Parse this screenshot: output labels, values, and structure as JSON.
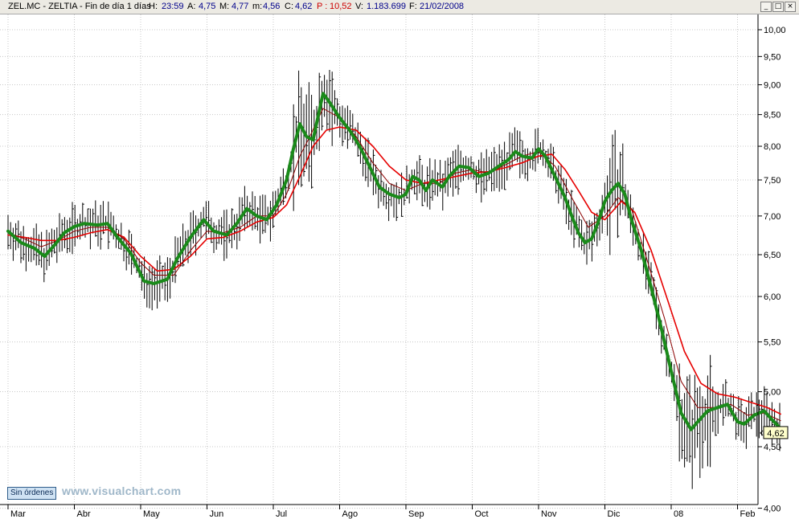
{
  "header": {
    "symbol": "ZEL.MC - ZELTIA - Fin de día 1 días",
    "h_label": "H:",
    "h_value": "23:59",
    "a_label": "A:",
    "a_value": "4,75",
    "m_label": "M:",
    "m_value": "4,77",
    "min_label": "m:",
    "min_value": "4,56",
    "c_label": "C:",
    "c_value": "4,62",
    "p_label": "P :",
    "p_value": "10,52",
    "v_label": "V:",
    "v_value": "1.183.699",
    "f_label": "F:",
    "f_value": "21/02/2008"
  },
  "window_buttons": {
    "minimize": "_",
    "maximize": "□",
    "close": "×"
  },
  "badge_label": "Sin órdenes",
  "watermark": "www.visualchart.com",
  "price_label": "4,62",
  "colors": {
    "ma_fast": "#1a8a1a",
    "ma_mid": "#8b0000",
    "ma_slow": "#e60000",
    "bars": "#000000",
    "grid": "#c8c8c8",
    "price_box": "#ffffcc"
  },
  "chart_data": {
    "type": "line",
    "y_scale": "log",
    "ylim": [
      3.87,
      10.3
    ],
    "y_ticks": [
      {
        "v": 4.0,
        "label": "4,00"
      },
      {
        "v": 4.5,
        "label": "4,50"
      },
      {
        "v": 5.0,
        "label": "5,00"
      },
      {
        "v": 5.5,
        "label": "5,50"
      },
      {
        "v": 6.0,
        "label": "6,00"
      },
      {
        "v": 6.5,
        "label": "6,50"
      },
      {
        "v": 7.0,
        "label": "7,00"
      },
      {
        "v": 7.5,
        "label": "7,50"
      },
      {
        "v": 8.0,
        "label": "8,00"
      },
      {
        "v": 8.5,
        "label": "8,50"
      },
      {
        "v": 9.0,
        "label": "9,00"
      },
      {
        "v": 9.5,
        "label": "9,50"
      },
      {
        "v": 10.0,
        "label": "10,00"
      }
    ],
    "x_ticks": [
      {
        "t": 0,
        "label": "Mar"
      },
      {
        "t": 1,
        "label": "Abr"
      },
      {
        "t": 2,
        "label": "May"
      },
      {
        "t": 3,
        "label": "Jun"
      },
      {
        "t": 4,
        "label": "Jul"
      },
      {
        "t": 5,
        "label": "Ago"
      },
      {
        "t": 6,
        "label": "Sep"
      },
      {
        "t": 7,
        "label": "Oct"
      },
      {
        "t": 8,
        "label": "Nov"
      },
      {
        "t": 9,
        "label": "Dic"
      },
      {
        "t": 10,
        "label": "08"
      },
      {
        "t": 11,
        "label": "Feb"
      }
    ],
    "t_end": 11.65,
    "last_close": 4.62,
    "grid": true,
    "series": [
      {
        "style": "bold",
        "points": [
          [
            0.0,
            6.8
          ],
          [
            0.2,
            6.65
          ],
          [
            0.4,
            6.58
          ],
          [
            0.55,
            6.48
          ],
          [
            0.7,
            6.62
          ],
          [
            0.85,
            6.78
          ],
          [
            1.0,
            6.86
          ],
          [
            1.15,
            6.9
          ],
          [
            1.35,
            6.88
          ],
          [
            1.5,
            6.9
          ],
          [
            1.65,
            6.72
          ],
          [
            1.85,
            6.52
          ],
          [
            2.05,
            6.18
          ],
          [
            2.2,
            6.15
          ],
          [
            2.4,
            6.2
          ],
          [
            2.55,
            6.45
          ],
          [
            2.75,
            6.72
          ],
          [
            2.95,
            6.95
          ],
          [
            3.1,
            6.8
          ],
          [
            3.3,
            6.75
          ],
          [
            3.45,
            6.9
          ],
          [
            3.6,
            7.1
          ],
          [
            3.75,
            7.0
          ],
          [
            3.9,
            6.95
          ],
          [
            4.05,
            7.15
          ],
          [
            4.2,
            7.5
          ],
          [
            4.3,
            7.95
          ],
          [
            4.4,
            8.35
          ],
          [
            4.5,
            8.15
          ],
          [
            4.6,
            8.1
          ],
          [
            4.7,
            8.6
          ],
          [
            4.75,
            8.85
          ],
          [
            4.85,
            8.7
          ],
          [
            5.0,
            8.45
          ],
          [
            5.15,
            8.25
          ],
          [
            5.3,
            8.0
          ],
          [
            5.45,
            7.7
          ],
          [
            5.6,
            7.4
          ],
          [
            5.75,
            7.3
          ],
          [
            5.9,
            7.25
          ],
          [
            6.0,
            7.3
          ],
          [
            6.1,
            7.55
          ],
          [
            6.2,
            7.5
          ],
          [
            6.3,
            7.35
          ],
          [
            6.4,
            7.5
          ],
          [
            6.55,
            7.4
          ],
          [
            6.65,
            7.55
          ],
          [
            6.8,
            7.7
          ],
          [
            6.95,
            7.68
          ],
          [
            7.1,
            7.55
          ],
          [
            7.25,
            7.6
          ],
          [
            7.4,
            7.7
          ],
          [
            7.55,
            7.8
          ],
          [
            7.65,
            7.92
          ],
          [
            7.75,
            7.85
          ],
          [
            7.9,
            7.82
          ],
          [
            8.0,
            7.96
          ],
          [
            8.1,
            7.85
          ],
          [
            8.25,
            7.55
          ],
          [
            8.4,
            7.25
          ],
          [
            8.5,
            7.0
          ],
          [
            8.6,
            6.78
          ],
          [
            8.7,
            6.65
          ],
          [
            8.8,
            6.7
          ],
          [
            8.9,
            6.92
          ],
          [
            9.0,
            7.2
          ],
          [
            9.1,
            7.35
          ],
          [
            9.2,
            7.45
          ],
          [
            9.3,
            7.3
          ],
          [
            9.4,
            6.95
          ],
          [
            9.55,
            6.55
          ],
          [
            9.7,
            6.1
          ],
          [
            9.85,
            5.65
          ],
          [
            10.0,
            5.2
          ],
          [
            10.15,
            4.8
          ],
          [
            10.3,
            4.65
          ],
          [
            10.4,
            4.72
          ],
          [
            10.55,
            4.82
          ],
          [
            10.7,
            4.85
          ],
          [
            10.85,
            4.88
          ],
          [
            11.0,
            4.72
          ],
          [
            11.1,
            4.7
          ],
          [
            11.25,
            4.78
          ],
          [
            11.4,
            4.82
          ],
          [
            11.55,
            4.72
          ],
          [
            11.65,
            4.66
          ]
        ]
      },
      {
        "style": "thin",
        "points": [
          [
            0.0,
            6.78
          ],
          [
            0.25,
            6.7
          ],
          [
            0.5,
            6.6
          ],
          [
            0.75,
            6.68
          ],
          [
            1.0,
            6.8
          ],
          [
            1.25,
            6.85
          ],
          [
            1.5,
            6.85
          ],
          [
            1.75,
            6.7
          ],
          [
            2.0,
            6.4
          ],
          [
            2.2,
            6.25
          ],
          [
            2.5,
            6.25
          ],
          [
            2.75,
            6.55
          ],
          [
            3.0,
            6.8
          ],
          [
            3.25,
            6.78
          ],
          [
            3.5,
            6.85
          ],
          [
            3.75,
            7.0
          ],
          [
            4.0,
            7.0
          ],
          [
            4.2,
            7.3
          ],
          [
            4.4,
            7.85
          ],
          [
            4.55,
            8.15
          ],
          [
            4.75,
            8.6
          ],
          [
            5.0,
            8.45
          ],
          [
            5.25,
            8.15
          ],
          [
            5.5,
            7.75
          ],
          [
            5.75,
            7.45
          ],
          [
            6.0,
            7.35
          ],
          [
            6.25,
            7.45
          ],
          [
            6.5,
            7.45
          ],
          [
            6.75,
            7.6
          ],
          [
            7.0,
            7.65
          ],
          [
            7.25,
            7.6
          ],
          [
            7.5,
            7.72
          ],
          [
            7.75,
            7.85
          ],
          [
            8.0,
            7.92
          ],
          [
            8.25,
            7.7
          ],
          [
            8.5,
            7.25
          ],
          [
            8.75,
            6.85
          ],
          [
            9.0,
            7.0
          ],
          [
            9.2,
            7.25
          ],
          [
            9.4,
            7.1
          ],
          [
            9.65,
            6.4
          ],
          [
            9.9,
            5.75
          ],
          [
            10.15,
            5.1
          ],
          [
            10.4,
            4.85
          ],
          [
            10.65,
            4.85
          ],
          [
            10.9,
            4.88
          ],
          [
            11.15,
            4.78
          ],
          [
            11.4,
            4.8
          ],
          [
            11.65,
            4.73
          ]
        ]
      },
      {
        "style": "slow",
        "points": [
          [
            0.0,
            6.75
          ],
          [
            0.25,
            6.72
          ],
          [
            0.5,
            6.68
          ],
          [
            0.75,
            6.68
          ],
          [
            1.0,
            6.72
          ],
          [
            1.25,
            6.78
          ],
          [
            1.5,
            6.82
          ],
          [
            1.75,
            6.72
          ],
          [
            2.0,
            6.48
          ],
          [
            2.25,
            6.3
          ],
          [
            2.5,
            6.32
          ],
          [
            2.75,
            6.48
          ],
          [
            3.0,
            6.7
          ],
          [
            3.25,
            6.72
          ],
          [
            3.5,
            6.8
          ],
          [
            3.75,
            6.92
          ],
          [
            4.0,
            6.98
          ],
          [
            4.2,
            7.15
          ],
          [
            4.4,
            7.55
          ],
          [
            4.6,
            8.0
          ],
          [
            4.8,
            8.25
          ],
          [
            5.0,
            8.3
          ],
          [
            5.25,
            8.25
          ],
          [
            5.5,
            8.0
          ],
          [
            5.75,
            7.7
          ],
          [
            6.0,
            7.5
          ],
          [
            6.25,
            7.45
          ],
          [
            6.5,
            7.5
          ],
          [
            6.75,
            7.55
          ],
          [
            7.0,
            7.6
          ],
          [
            7.25,
            7.62
          ],
          [
            7.5,
            7.68
          ],
          [
            7.75,
            7.75
          ],
          [
            8.0,
            7.85
          ],
          [
            8.2,
            7.88
          ],
          [
            8.4,
            7.65
          ],
          [
            8.6,
            7.35
          ],
          [
            8.8,
            7.05
          ],
          [
            9.0,
            6.95
          ],
          [
            9.25,
            7.2
          ],
          [
            9.45,
            7.05
          ],
          [
            9.7,
            6.55
          ],
          [
            9.95,
            5.95
          ],
          [
            10.2,
            5.4
          ],
          [
            10.45,
            5.08
          ],
          [
            10.7,
            4.98
          ],
          [
            10.95,
            4.95
          ],
          [
            11.2,
            4.9
          ],
          [
            11.45,
            4.85
          ],
          [
            11.65,
            4.79
          ]
        ]
      }
    ]
  }
}
